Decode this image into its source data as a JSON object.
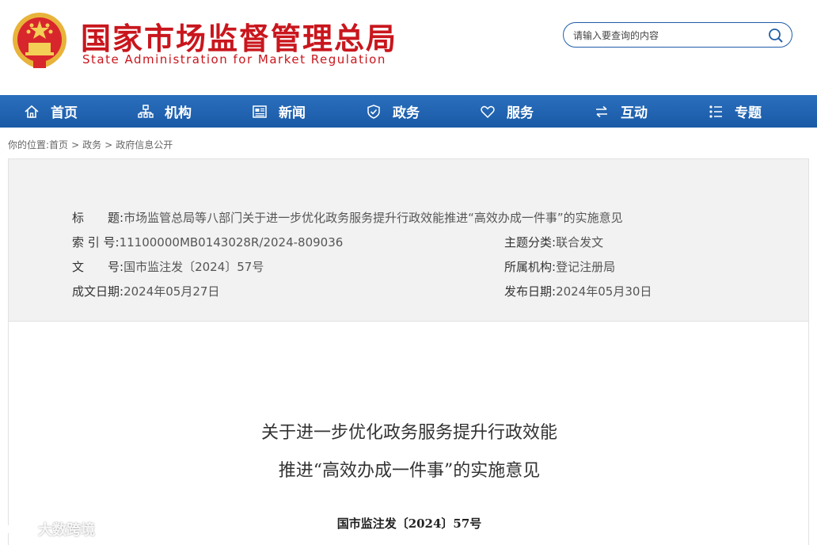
{
  "header": {
    "title_cn": "国家市场监督管理总局",
    "title_en": "State Administration for Market Regulation",
    "emblem_icon": "national-emblem-icon",
    "brand_color": "#c9161d",
    "search": {
      "placeholder": "请输入要查询的内容",
      "icon": "search-icon"
    }
  },
  "nav": {
    "color": "#1f64b0",
    "items": [
      {
        "label": "首页",
        "icon": "home-icon"
      },
      {
        "label": "机构",
        "icon": "org-chart-icon"
      },
      {
        "label": "新闻",
        "icon": "newspaper-icon"
      },
      {
        "label": "政务",
        "icon": "shield-icon"
      },
      {
        "label": "服务",
        "icon": "heart-icon"
      },
      {
        "label": "互动",
        "icon": "exchange-arrows-icon"
      },
      {
        "label": "专题",
        "icon": "list-icon"
      }
    ]
  },
  "breadcrumb": {
    "prefix": "你的位置:",
    "items": [
      "首页",
      "政务",
      "政府信息公开"
    ],
    "separator": ">"
  },
  "meta": {
    "title_label": "标　　题:",
    "title_value": "市场监管总局等八部门关于进一步优化政务服务提升行政效能推进“高效办成一件事”的实施意见",
    "index_label": "索 引 号:",
    "index_value": "11100000MB0143028R/2024-809036",
    "category_label": "主题分类:",
    "category_value": "联合发文",
    "doc_label": "文　　号:",
    "doc_value": "国市监注发〔2024〕57号",
    "org_label": "所属机构:",
    "org_value": "登记注册局",
    "created_label": "成文日期:",
    "created_value": "2024年05月27日",
    "published_label": "发布日期:",
    "published_value": "2024年05月30日"
  },
  "document": {
    "title_line1": "关于进一步优化政务服务提升行政效能",
    "title_line2": "推进“高效办成一件事”的实施意见",
    "number": "国市监注发〔2024〕57号"
  },
  "watermark": {
    "text": "大数跨境"
  }
}
